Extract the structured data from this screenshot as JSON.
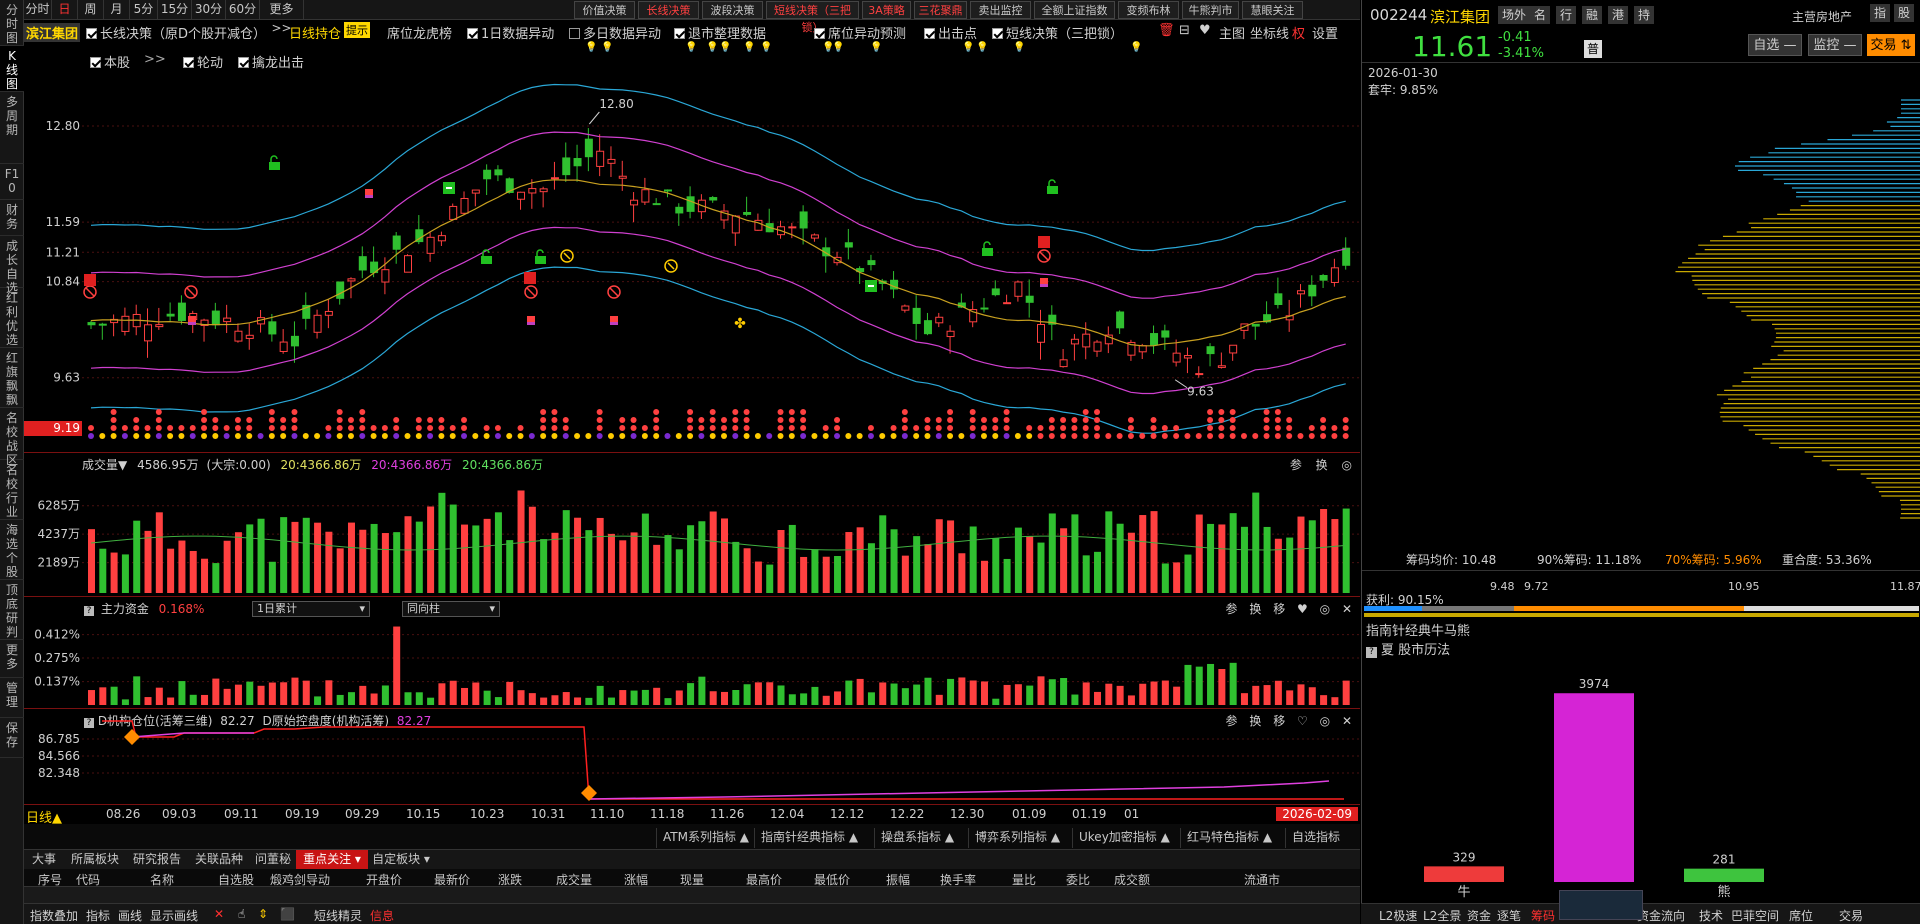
{
  "left_nav": [
    "分时图",
    "K线图",
    "多周期",
    "F10",
    "财务",
    "成长自选",
    "红利优选",
    "红旗飘飘",
    "名校战区",
    "名校行业",
    "海选个股",
    "顶底研判",
    "更多",
    "管理",
    "保存"
  ],
  "periods": [
    "分时",
    "日",
    "周",
    "月",
    "5分",
    "15分",
    "30分",
    "60分",
    "更多>>"
  ],
  "active_period": "日",
  "top_tools": [
    {
      "label": "价值决策",
      "red": false
    },
    {
      "label": "长线决策",
      "red": true
    },
    {
      "label": "波段决策",
      "red": false
    },
    {
      "label": "短线决策（三把锁）",
      "red": true
    },
    {
      "label": "3A策略",
      "red": true
    },
    {
      "label": "三花聚鼎",
      "red": true
    },
    {
      "label": "卖出监控",
      "red": false
    },
    {
      "label": "全额上证指数",
      "red": false
    },
    {
      "label": "变频布林",
      "red": false
    },
    {
      "label": "牛熊判市",
      "red": false
    },
    {
      "label": "慧眼关注",
      "red": false
    }
  ],
  "strategy_bar": {
    "stock_name": "滨江集团",
    "long_strategy": "长线决策（原D个股开减仓）",
    "hold_label": "日线持仓",
    "tip_badge": "提示",
    "dragon_tiger": "席位龙虎榜",
    "items": [
      {
        "label": "1日数据异动",
        "checked": true
      },
      {
        "label": "多日数据异动",
        "checked": false
      },
      {
        "label": "退市整理数据",
        "checked": true
      },
      {
        "label": "席位异动预测",
        "checked": true
      },
      {
        "label": "出击点",
        "checked": true
      },
      {
        "label": "短线决策（三把锁）",
        "checked": true
      }
    ],
    "right_tools": [
      "主图",
      "坐标线",
      "权",
      "设置"
    ],
    "row2": [
      {
        "label": "本股",
        "checked": true
      },
      {
        "label": "轮动",
        "checked": true
      },
      {
        "label": "擒龙出击",
        "checked": true
      }
    ],
    "more": ">>"
  },
  "price_axis": [
    "12.80",
    "11.59",
    "11.21",
    "10.84",
    "9.63"
  ],
  "price_current_badge": "9.19",
  "annotations": {
    "high": "12.80",
    "low": "9.63"
  },
  "volume_panel": {
    "title": "成交量▼",
    "value": "4586.95万",
    "bulk": "(大宗:0.00)",
    "ma1": "20:4366.86万",
    "ma2": "20:4366.86万",
    "ma3": "20:4366.86万",
    "axis": [
      "6285万",
      "4237万",
      "2189万"
    ],
    "icons": [
      "参",
      "换",
      "◎"
    ]
  },
  "capital_panel": {
    "title": "主力资金",
    "value": "0.168%",
    "select1": "1日累计",
    "select2": "同向柱",
    "axis": [
      "0.412%",
      "0.275%",
      "0.137%"
    ],
    "icons": [
      "参",
      "换",
      "移",
      "♥",
      "◎",
      "✕"
    ]
  },
  "inst_panel": {
    "title": "D机构仓位(活筹三维)",
    "value1": "82.27",
    "title2": "D原始控盘度(机构活筹)",
    "value2": "82.27",
    "axis": [
      "86.785",
      "84.566",
      "82.348"
    ],
    "icons": [
      "参",
      "换",
      "移",
      "♡",
      "◎",
      "✕"
    ]
  },
  "date_axis": [
    "08.26",
    "09.03",
    "09.11",
    "09.19",
    "09.29",
    "10.15",
    "10.23",
    "10.31",
    "11.10",
    "11.18",
    "11.26",
    "12.04",
    "12.12",
    "12.22",
    "12.30",
    "01.09",
    "01.19",
    "01"
  ],
  "date_current": "2026-02-09",
  "period_label": "日线▲",
  "indicator_buttons": [
    "ATM系列指标 ▲",
    "指南针经典指标 ▲",
    "操盘系指标 ▲",
    "博弈系列指标 ▲",
    "Ukey加密指标 ▲",
    "红马特色指标 ▲",
    "自选指标"
  ],
  "bottom_tabs": [
    "大事",
    "所属板块",
    "研究报告",
    "关联品种",
    "问董秘",
    "重点关注 ▾",
    "自定板块 ▾"
  ],
  "active_bottom_tab": "重点关注 ▾",
  "table_headers": [
    "序号",
    "代码",
    "名称",
    "自选股",
    "煅鸡剑导动",
    "开盘价",
    "最新价",
    "涨跌",
    "成交量",
    "涨幅",
    "现量",
    "最高价",
    "最低价",
    "振幅",
    "换手率",
    "量比",
    "委比",
    "成交额",
    "流通市"
  ],
  "status_bar": [
    "指数叠加",
    "指标",
    "画线",
    "显示画线",
    "✕",
    "☝",
    "⇕",
    "⬛",
    "短线精灵",
    "信息"
  ],
  "right_pane": {
    "code": "002244",
    "name": "滨江集团",
    "tags": [
      "场外",
      "名",
      "行",
      "融",
      "港",
      "持"
    ],
    "industry": "主营房地产",
    "top_btns": [
      "指",
      "股"
    ],
    "price": "11.61",
    "change": "-0.41",
    "pct": "-3.41%",
    "badge": "普",
    "btn_self": "自选 —",
    "btn_monitor": "监控 —",
    "btn_trade": "交易 ⇅",
    "chip_date": "2026-01-30",
    "chip_trap": "套牢: 9.85%",
    "chip_stats": {
      "avg": "筹码均价: 10.48",
      "c90": "90%筹码: 11.18%",
      "c70": "70%筹码: 5.96%",
      "overlap": "重合度: 53.36%"
    },
    "profit": "获利: 90.15%",
    "profit_ticks": [
      "9.48",
      "9.72",
      "10.95",
      "11.87"
    ],
    "bull_title": "指南针经典牛马熊",
    "bull_sub": "夏  股市历法",
    "bars": [
      {
        "label": "牛",
        "value": 329,
        "color": "#ee3b3b"
      },
      {
        "label": "",
        "value": 3974,
        "color": "#d524d5"
      },
      {
        "label": "熊",
        "value": 281,
        "color": "#3ec43e"
      }
    ],
    "status": [
      "L2极速",
      "L2全景",
      "资金",
      "逐笔",
      "筹码",
      "",
      "",
      "",
      "资金流向",
      "技术",
      "巴菲空间",
      "席位",
      "交易"
    ]
  }
}
